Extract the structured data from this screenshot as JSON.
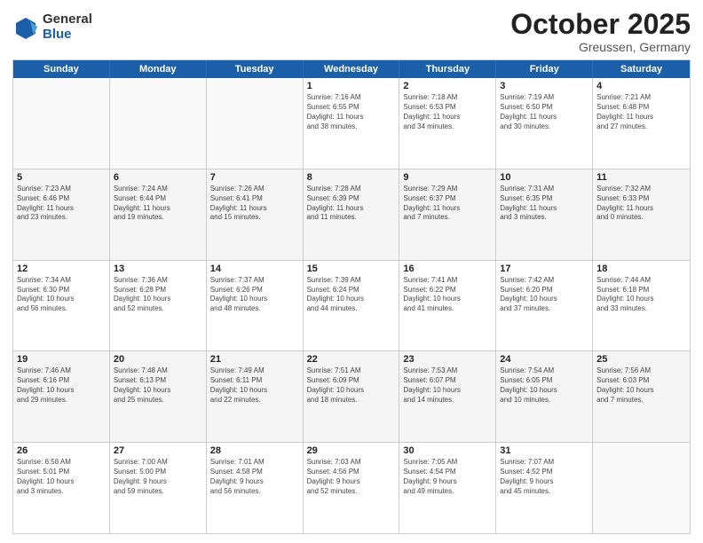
{
  "logo": {
    "general": "General",
    "blue": "Blue"
  },
  "title": "October 2025",
  "location": "Greussen, Germany",
  "weekdays": [
    "Sunday",
    "Monday",
    "Tuesday",
    "Wednesday",
    "Thursday",
    "Friday",
    "Saturday"
  ],
  "weeks": [
    [
      {
        "day": "",
        "info": ""
      },
      {
        "day": "",
        "info": ""
      },
      {
        "day": "",
        "info": ""
      },
      {
        "day": "1",
        "info": "Sunrise: 7:16 AM\nSunset: 6:55 PM\nDaylight: 11 hours\nand 38 minutes."
      },
      {
        "day": "2",
        "info": "Sunrise: 7:18 AM\nSunset: 6:53 PM\nDaylight: 11 hours\nand 34 minutes."
      },
      {
        "day": "3",
        "info": "Sunrise: 7:19 AM\nSunset: 6:50 PM\nDaylight: 11 hours\nand 30 minutes."
      },
      {
        "day": "4",
        "info": "Sunrise: 7:21 AM\nSunset: 6:48 PM\nDaylight: 11 hours\nand 27 minutes."
      }
    ],
    [
      {
        "day": "5",
        "info": "Sunrise: 7:23 AM\nSunset: 6:46 PM\nDaylight: 11 hours\nand 23 minutes."
      },
      {
        "day": "6",
        "info": "Sunrise: 7:24 AM\nSunset: 6:44 PM\nDaylight: 11 hours\nand 19 minutes."
      },
      {
        "day": "7",
        "info": "Sunrise: 7:26 AM\nSunset: 6:41 PM\nDaylight: 11 hours\nand 15 minutes."
      },
      {
        "day": "8",
        "info": "Sunrise: 7:28 AM\nSunset: 6:39 PM\nDaylight: 11 hours\nand 11 minutes."
      },
      {
        "day": "9",
        "info": "Sunrise: 7:29 AM\nSunset: 6:37 PM\nDaylight: 11 hours\nand 7 minutes."
      },
      {
        "day": "10",
        "info": "Sunrise: 7:31 AM\nSunset: 6:35 PM\nDaylight: 11 hours\nand 3 minutes."
      },
      {
        "day": "11",
        "info": "Sunrise: 7:32 AM\nSunset: 6:33 PM\nDaylight: 11 hours\nand 0 minutes."
      }
    ],
    [
      {
        "day": "12",
        "info": "Sunrise: 7:34 AM\nSunset: 6:30 PM\nDaylight: 10 hours\nand 56 minutes."
      },
      {
        "day": "13",
        "info": "Sunrise: 7:36 AM\nSunset: 6:28 PM\nDaylight: 10 hours\nand 52 minutes."
      },
      {
        "day": "14",
        "info": "Sunrise: 7:37 AM\nSunset: 6:26 PM\nDaylight: 10 hours\nand 48 minutes."
      },
      {
        "day": "15",
        "info": "Sunrise: 7:39 AM\nSunset: 6:24 PM\nDaylight: 10 hours\nand 44 minutes."
      },
      {
        "day": "16",
        "info": "Sunrise: 7:41 AM\nSunset: 6:22 PM\nDaylight: 10 hours\nand 41 minutes."
      },
      {
        "day": "17",
        "info": "Sunrise: 7:42 AM\nSunset: 6:20 PM\nDaylight: 10 hours\nand 37 minutes."
      },
      {
        "day": "18",
        "info": "Sunrise: 7:44 AM\nSunset: 6:18 PM\nDaylight: 10 hours\nand 33 minutes."
      }
    ],
    [
      {
        "day": "19",
        "info": "Sunrise: 7:46 AM\nSunset: 6:16 PM\nDaylight: 10 hours\nand 29 minutes."
      },
      {
        "day": "20",
        "info": "Sunrise: 7:48 AM\nSunset: 6:13 PM\nDaylight: 10 hours\nand 25 minutes."
      },
      {
        "day": "21",
        "info": "Sunrise: 7:49 AM\nSunset: 6:11 PM\nDaylight: 10 hours\nand 22 minutes."
      },
      {
        "day": "22",
        "info": "Sunrise: 7:51 AM\nSunset: 6:09 PM\nDaylight: 10 hours\nand 18 minutes."
      },
      {
        "day": "23",
        "info": "Sunrise: 7:53 AM\nSunset: 6:07 PM\nDaylight: 10 hours\nand 14 minutes."
      },
      {
        "day": "24",
        "info": "Sunrise: 7:54 AM\nSunset: 6:05 PM\nDaylight: 10 hours\nand 10 minutes."
      },
      {
        "day": "25",
        "info": "Sunrise: 7:56 AM\nSunset: 6:03 PM\nDaylight: 10 hours\nand 7 minutes."
      }
    ],
    [
      {
        "day": "26",
        "info": "Sunrise: 6:58 AM\nSunset: 5:01 PM\nDaylight: 10 hours\nand 3 minutes."
      },
      {
        "day": "27",
        "info": "Sunrise: 7:00 AM\nSunset: 5:00 PM\nDaylight: 9 hours\nand 59 minutes."
      },
      {
        "day": "28",
        "info": "Sunrise: 7:01 AM\nSunset: 4:58 PM\nDaylight: 9 hours\nand 56 minutes."
      },
      {
        "day": "29",
        "info": "Sunrise: 7:03 AM\nSunset: 4:56 PM\nDaylight: 9 hours\nand 52 minutes."
      },
      {
        "day": "30",
        "info": "Sunrise: 7:05 AM\nSunset: 4:54 PM\nDaylight: 9 hours\nand 49 minutes."
      },
      {
        "day": "31",
        "info": "Sunrise: 7:07 AM\nSunset: 4:52 PM\nDaylight: 9 hours\nand 45 minutes."
      },
      {
        "day": "",
        "info": ""
      }
    ]
  ]
}
